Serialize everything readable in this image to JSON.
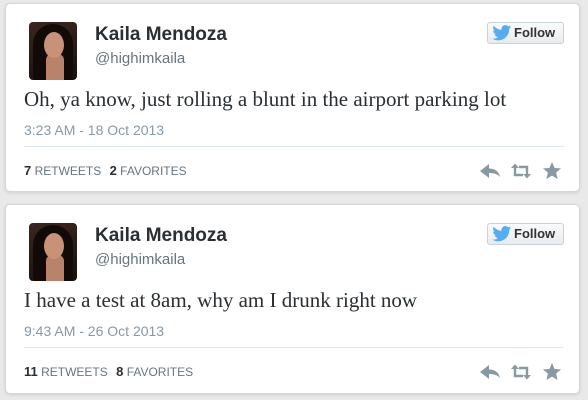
{
  "colors": {
    "page_background": "#e9e9e9",
    "card_background": "#ffffff",
    "name_text": "#292f33",
    "handle_text": "#66757f",
    "timestamp_text": "#8899a6",
    "twitter_blue": "#55acee",
    "action_icon": "#8899a6"
  },
  "follow_button": {
    "label": "Follow",
    "icon": "twitter-bird-icon"
  },
  "action_icons": [
    "reply-icon",
    "retweet-icon",
    "favorite-icon"
  ],
  "tweets": [
    {
      "author": {
        "name": "Kaila Mendoza",
        "handle": "@highimkaila",
        "avatar": "avatar"
      },
      "text": "Oh, ya know, just rolling a blunt in the airport parking lot",
      "timestamp": "3:23 AM - 18 Oct 2013",
      "retweets": "7",
      "retweets_label": "Retweets",
      "favorites": "2",
      "favorites_label": "Favorites"
    },
    {
      "author": {
        "name": "Kaila Mendoza",
        "handle": "@highimkaila",
        "avatar": "avatar"
      },
      "text": "I have a test at 8am, why am I drunk right now",
      "timestamp": "9:43 AM - 26 Oct 2013",
      "retweets": "11",
      "retweets_label": "Retweets",
      "favorites": "8",
      "favorites_label": "Favorites"
    }
  ]
}
